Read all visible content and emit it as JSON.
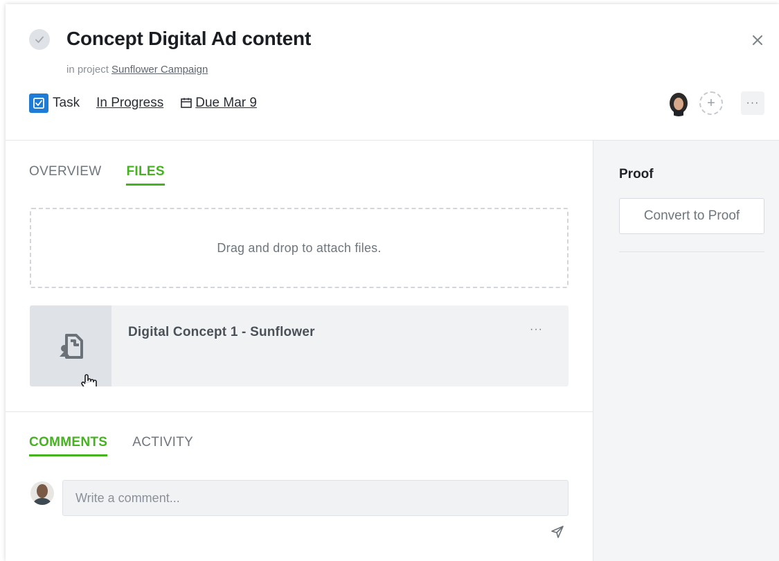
{
  "task": {
    "title": "Concept Digital Ad content",
    "project_prefix": "in project",
    "project_name": "Sunflower Campaign",
    "type_label": "Task",
    "status": "In Progress",
    "due": "Due Mar 9",
    "more": "···",
    "add_follower": "+"
  },
  "tabs": [
    {
      "label": "OVERVIEW",
      "active": false
    },
    {
      "label": "FILES",
      "active": true
    }
  ],
  "files": {
    "dropzone_text": "Drag and drop to attach files.",
    "items": [
      {
        "name": "Digital Concept 1 - Sunflower",
        "more": "···"
      }
    ]
  },
  "comment_tabs": [
    {
      "label": "COMMENTS",
      "active": true
    },
    {
      "label": "ACTIVITY",
      "active": false
    }
  ],
  "comment_box": {
    "placeholder": "Write a comment...",
    "value": ""
  },
  "sidebar": {
    "title": "Proof",
    "button_label": "Convert to Proof"
  },
  "colors": {
    "accent_green": "#45b21f",
    "task_blue": "#1e7bd6"
  }
}
